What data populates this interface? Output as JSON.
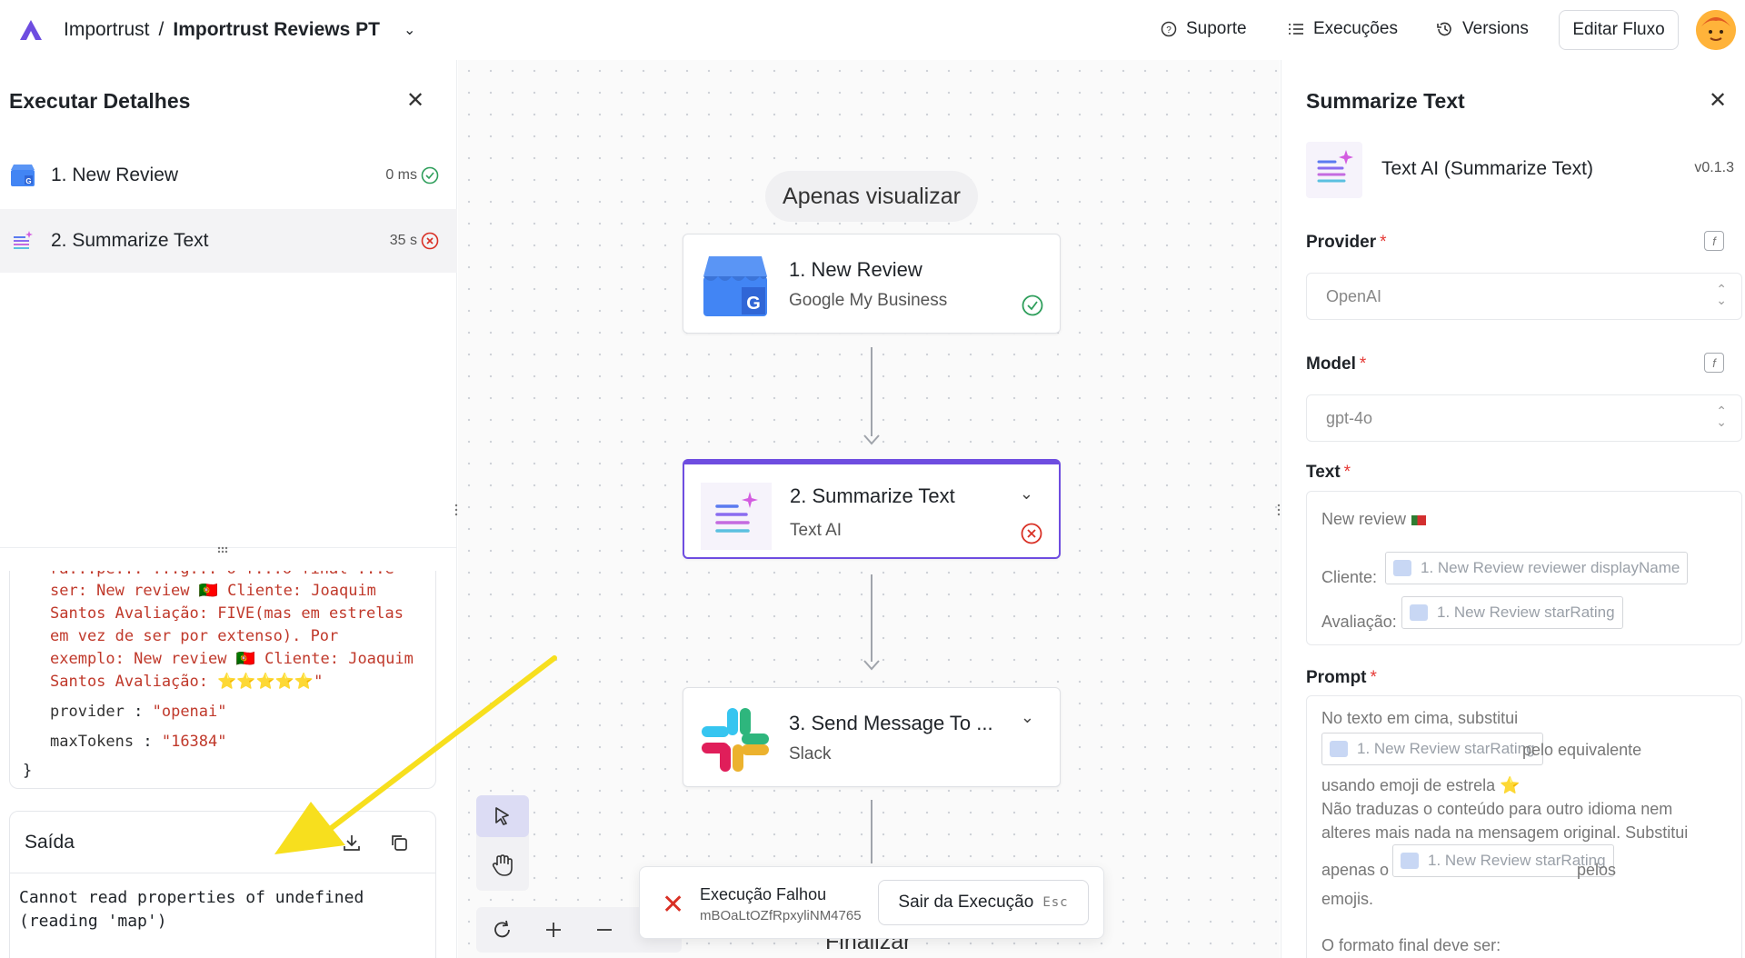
{
  "header": {
    "org": "Importrust",
    "separator": "/",
    "project": "Importrust Reviews PT",
    "nav": [
      {
        "label": "Suporte",
        "icon": "help-circle-icon"
      },
      {
        "label": "Execuções",
        "icon": "list-icon"
      },
      {
        "label": "Versions",
        "icon": "history-icon"
      }
    ],
    "edit_button": "Editar Fluxo"
  },
  "run_details": {
    "title": "Executar Detalhes",
    "steps": [
      {
        "name": "1. New Review",
        "duration": "0 ms",
        "status": "success"
      },
      {
        "name": "2. Summarize Text",
        "duration": "35 s",
        "status": "failed"
      }
    ],
    "input_lines": [
      "ra...pe... ...g... o f...o final ...e",
      "ser: New review 🇵🇹 Cliente: Joaquim",
      "Santos Avaliação: FIVE(mas em estrelas",
      "em vez de ser por extenso). Por",
      "exemplo: New review 🇵🇹 Cliente: Joaquim",
      "Santos Avaliação: ⭐⭐⭐⭐⭐\""
    ],
    "fields": [
      {
        "key": "provider",
        "value": "\"openai\""
      },
      {
        "key": "maxTokens",
        "value": "\"16384\""
      }
    ],
    "closing_brace": "}",
    "output": {
      "title": "Saída",
      "error": "Cannot read properties of undefined\n(reading 'map')"
    }
  },
  "canvas": {
    "view_only": "Apenas visualizar",
    "nodes": [
      {
        "title": "1. New Review",
        "subtitle": "Google My Business",
        "status": "success"
      },
      {
        "title": "2. Summarize Text",
        "subtitle": "Text AI",
        "status": "failed"
      },
      {
        "title": "3. Send Message To ...",
        "subtitle": "Slack",
        "status": "pending"
      }
    ],
    "end_label": "Finalizar",
    "toast": {
      "title": "Execução Falhou",
      "run_id": "mBOaLtOZfRpxyliNM4765",
      "exit_button": "Sair da Execução",
      "exit_key": "Esc"
    }
  },
  "step_panel": {
    "title": "Summarize Text",
    "app_name": "Text AI (Summarize Text)",
    "version": "v0.1.3",
    "provider": {
      "label": "Provider",
      "value": "OpenAI"
    },
    "model": {
      "label": "Model",
      "value": "gpt-4o"
    },
    "text": {
      "label": "Text",
      "line1": "New review",
      "cliente_label": "Cliente:",
      "cliente_chip": "1. New Review reviewer displayName",
      "avaliacao_label": "Avaliação:",
      "avaliacao_chip": "1. New Review starRating"
    },
    "prompt": {
      "label": "Prompt",
      "line1": "No texto em cima, substitui",
      "chip1": "1. New Review starRating",
      "after_chip1": "pelo equivalente",
      "line3": "usando emoji de estrela",
      "line4": "Não traduzas o conteúdo para outro idioma nem",
      "line5": "alteres mais nada na mensagem original. Substitui",
      "before_chip2": "apenas o",
      "chip2": "1. New Review starRating",
      "after_chip2": "pelos",
      "line7": "emojis.",
      "line8": "O formato final deve ser:"
    }
  }
}
